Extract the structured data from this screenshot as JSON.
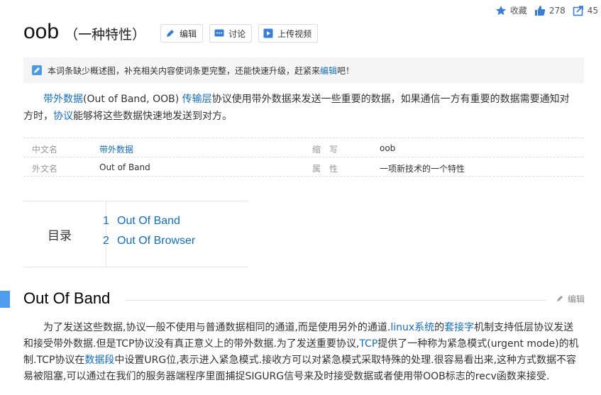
{
  "top_actions": {
    "favorite_label": "收藏",
    "like_count": "278",
    "share_count": "45"
  },
  "title": {
    "main": "oob",
    "sub": "（一种特性）"
  },
  "title_buttons": {
    "edit": "编辑",
    "discuss": "讨论",
    "upload_video": "上传视频"
  },
  "notice": {
    "text_prefix": "本词条缺少概述图，补充相关内容使词条更完整，还能快速升级，赶紧来",
    "link": "编辑",
    "text_suffix": "吧！"
  },
  "summary": {
    "link1": "带外数据",
    "text1": "(Out of Band, OOB) ",
    "link2": "传输层",
    "text2": "协议使用带外数据来发送一些重要的数据，如果通信一方有重要的数据需要通知对方时，",
    "link3": "协议",
    "text3": "能够将这些数据快速地发送到对方。"
  },
  "basic_info": {
    "rows": [
      {
        "name1": "中文名",
        "value1": "带外数据",
        "name2": "缩　写",
        "value2": "oob"
      },
      {
        "name1": "外文名",
        "value1": "Out of Band",
        "name2": "属　性",
        "value2": "一项新技术的一个特性"
      }
    ]
  },
  "catalog": {
    "label": "目录",
    "items": [
      {
        "num": "1",
        "text": "Out Of Band"
      },
      {
        "num": "2",
        "text": "Out Of Browser"
      }
    ]
  },
  "section": {
    "title": "Out Of Band",
    "edit_label": "编辑",
    "para": {
      "t1": "为了发送这些数据,协议一般不使用与普通数据相同的通道,而是使用另外的通道.",
      "l1": "linux系统",
      "t2": "的",
      "l2": "套接字",
      "t3": "机制支持低层协议发送和接受带外数据.但是TCP协议没有真正意义上的带外数据.为了发送重要协议,",
      "l3": "TCP",
      "t4": "提供了一种称为紧急模式(urgent mode)的机制.TCP协议在",
      "l4": "数据段",
      "t5": "中设置URG位,表示进入紧急模式.接收方可以对紧急模式采取特殊的处理.很容易看出来,这种方式数据不容易被阻塞,可以通过在我们的服务器端程序里面捕捉SIGURG信号来及时接受数据或者使用带OOB标志的recv函数来接受."
    }
  },
  "colors": {
    "link": "#136ec2",
    "accent_bar": "#4f9cee",
    "notice_bg": "#f5f5f5"
  }
}
